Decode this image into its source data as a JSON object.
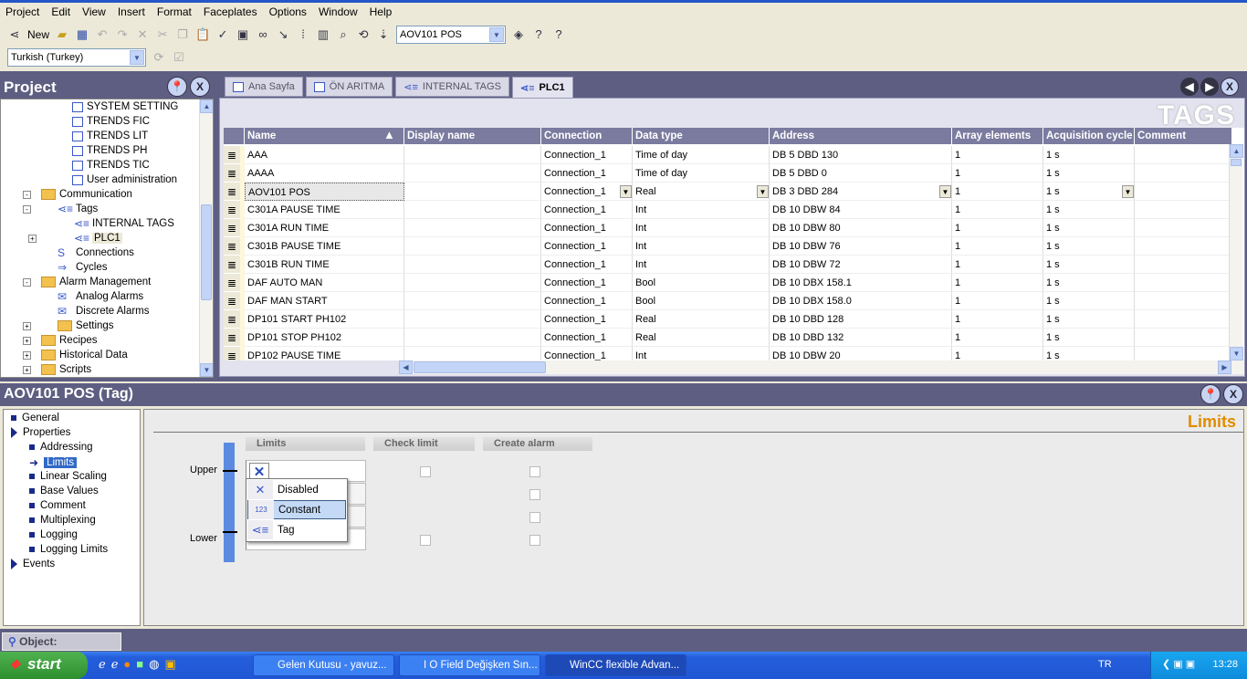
{
  "menu": [
    "Project",
    "Edit",
    "View",
    "Insert",
    "Format",
    "Faceplates",
    "Options",
    "Window",
    "Help"
  ],
  "toolbar": {
    "new_label": "New",
    "object_combo": "AOV101 POS",
    "language_combo": "Turkish (Turkey)"
  },
  "project": {
    "title": "Project",
    "tree": [
      {
        "label": "SYSTEM SETTING",
        "level": 3,
        "icon": "screen-icon"
      },
      {
        "label": "TRENDS FIC",
        "level": 3,
        "icon": "screen-icon"
      },
      {
        "label": "TRENDS LIT",
        "level": 3,
        "icon": "screen-icon"
      },
      {
        "label": "TRENDS PH",
        "level": 3,
        "icon": "screen-icon"
      },
      {
        "label": "TRENDS TIC",
        "level": 3,
        "icon": "screen-icon"
      },
      {
        "label": "User administration",
        "level": 3,
        "icon": "screen-icon"
      },
      {
        "label": "Communication",
        "level": 1,
        "icon": "folder-icon",
        "expander": "-"
      },
      {
        "label": "Tags",
        "level": 2,
        "icon": "tags-icon",
        "expander": "-"
      },
      {
        "label": "INTERNAL TAGS",
        "level": 4,
        "icon": "tags-icon"
      },
      {
        "label": "PLC1",
        "level": 4,
        "icon": "tags-icon",
        "expander": "+",
        "selected": true
      },
      {
        "label": "Connections",
        "level": 2,
        "icon": "connections-icon"
      },
      {
        "label": "Cycles",
        "level": 2,
        "icon": "cycles-icon"
      },
      {
        "label": "Alarm Management",
        "level": 1,
        "icon": "folder-icon",
        "expander": "-"
      },
      {
        "label": "Analog Alarms",
        "level": 2,
        "icon": "alarm-icon"
      },
      {
        "label": "Discrete Alarms",
        "level": 2,
        "icon": "alarm-icon"
      },
      {
        "label": "Settings",
        "level": 2,
        "icon": "folder-icon",
        "expander": "+"
      },
      {
        "label": "Recipes",
        "level": 1,
        "icon": "folder-icon",
        "expander": "+"
      },
      {
        "label": "Historical Data",
        "level": 1,
        "icon": "folder-icon",
        "expander": "+"
      },
      {
        "label": "Scripts",
        "level": 1,
        "icon": "folder-icon",
        "expander": "+"
      }
    ]
  },
  "tabs": [
    {
      "label": "Ana Sayfa",
      "icon": "screen-icon"
    },
    {
      "label": "ÖN ARITMA",
      "icon": "screen-icon"
    },
    {
      "label": "INTERNAL TAGS",
      "icon": "tags-icon"
    },
    {
      "label": "PLC1",
      "icon": "tags-icon",
      "active": true
    }
  ],
  "editor": {
    "title": "TAGS",
    "columns": [
      "Name",
      "Display name",
      "Connection",
      "Data type",
      "Address",
      "Array elements",
      "Acquisition cycle",
      "Comment"
    ],
    "rows": [
      [
        "AAA",
        "",
        "Connection_1",
        "Time of day",
        "DB 5 DBD 130",
        "1",
        "1 s",
        ""
      ],
      [
        "AAAA",
        "",
        "Connection_1",
        "Time of day",
        "DB 5 DBD 0",
        "1",
        "1 s",
        ""
      ],
      [
        "AOV101 POS",
        "",
        "Connection_1",
        "Real",
        "DB 3 DBD 284",
        "1",
        "1 s",
        ""
      ],
      [
        "C301A PAUSE TIME",
        "",
        "Connection_1",
        "Int",
        "DB 10 DBW 84",
        "1",
        "1 s",
        ""
      ],
      [
        "C301A RUN TIME",
        "",
        "Connection_1",
        "Int",
        "DB 10 DBW 80",
        "1",
        "1 s",
        ""
      ],
      [
        "C301B PAUSE TIME",
        "",
        "Connection_1",
        "Int",
        "DB 10 DBW 76",
        "1",
        "1 s",
        ""
      ],
      [
        "C301B RUN TIME",
        "",
        "Connection_1",
        "Int",
        "DB 10 DBW 72",
        "1",
        "1 s",
        ""
      ],
      [
        "DAF AUTO MAN",
        "",
        "Connection_1",
        "Bool",
        "DB 10 DBX 158.1",
        "1",
        "1 s",
        ""
      ],
      [
        "DAF MAN START",
        "",
        "Connection_1",
        "Bool",
        "DB 10 DBX 158.0",
        "1",
        "1 s",
        ""
      ],
      [
        "DP101 START PH102",
        "",
        "Connection_1",
        "Real",
        "DB 10 DBD 128",
        "1",
        "1 s",
        ""
      ],
      [
        "DP101 STOP PH102",
        "",
        "Connection_1",
        "Real",
        "DB 10 DBD 132",
        "1",
        "1 s",
        ""
      ],
      [
        "DP102 PAUSE TIME",
        "",
        "Connection_1",
        "Int",
        "DB 10 DBW 20",
        "1",
        "1 s",
        ""
      ]
    ],
    "selected_row": 2
  },
  "properties": {
    "title": "AOV101 POS (Tag)",
    "nav": [
      {
        "label": "General",
        "level": 0,
        "type": "square"
      },
      {
        "label": "Properties",
        "level": 0,
        "type": "triangle"
      },
      {
        "label": "Addressing",
        "level": 1,
        "type": "square"
      },
      {
        "label": "Limits",
        "level": 1,
        "type": "arrow",
        "selected": true
      },
      {
        "label": "Linear Scaling",
        "level": 1,
        "type": "square"
      },
      {
        "label": "Base Values",
        "level": 1,
        "type": "square"
      },
      {
        "label": "Comment",
        "level": 1,
        "type": "square"
      },
      {
        "label": "Multiplexing",
        "level": 1,
        "type": "square"
      },
      {
        "label": "Logging",
        "level": 1,
        "type": "square"
      },
      {
        "label": "Logging Limits",
        "level": 1,
        "type": "square"
      },
      {
        "label": "Events",
        "level": 0,
        "type": "triangle"
      }
    ],
    "section_title": "Limits",
    "col_limits": "Limits",
    "col_check": "Check limit",
    "col_alarm": "Create alarm",
    "upper": "Upper",
    "lower": "Lower",
    "popup": [
      {
        "label": "Disabled",
        "icon": "disabled-x-icon"
      },
      {
        "label": "Constant",
        "icon": "constant-123-icon",
        "highlighted": true
      },
      {
        "label": "Tag",
        "icon": "tag-icon"
      }
    ]
  },
  "object_bar": "Object:",
  "taskbar": {
    "start": "start",
    "tasks": [
      "Gelen Kutusu - yavuz...",
      "I O Field Değişken Sın...",
      "WinCC flexible Advan..."
    ],
    "lang": "TR",
    "clock": "13:28"
  },
  "colors": {
    "accent": "#5e5e82",
    "limits_title": "#e08c00",
    "selection": "#c3d9f5"
  }
}
